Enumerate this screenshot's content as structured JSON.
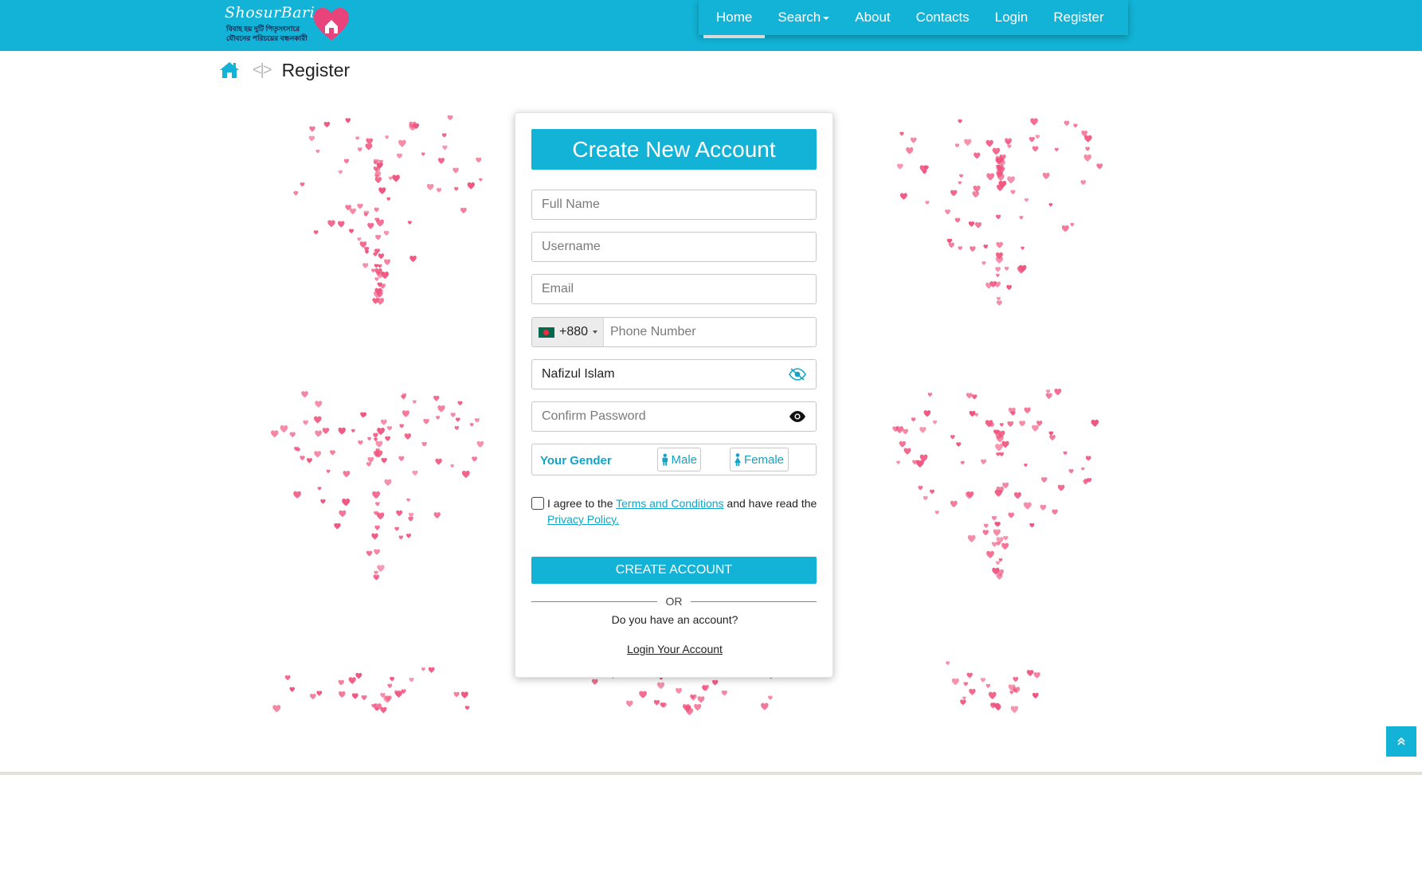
{
  "brand": {
    "name": "ShosurBari",
    "tagline_line1": "বিবাহ হয় দুটি পিতৃসংসারে",
    "tagline_line2": "যৌবনের পরিচয়ের বন্ধনকারী"
  },
  "nav": {
    "items": [
      {
        "label": "Home",
        "active": true
      },
      {
        "label": "Search",
        "dropdown": true
      },
      {
        "label": "About"
      },
      {
        "label": "Contacts"
      },
      {
        "label": "Login"
      },
      {
        "label": "Register"
      }
    ]
  },
  "breadcrumb": {
    "home_icon": "home-icon",
    "separator": "<|>",
    "current": "Register"
  },
  "form": {
    "title": "Create New Account",
    "full_name_placeholder": "Full Name",
    "username_placeholder": "Username",
    "email_placeholder": "Email",
    "phone": {
      "country_flag": "bangladesh-flag-icon",
      "dial_code": "+880",
      "placeholder": "Phone Number"
    },
    "password_value": "Nafizul Islam",
    "confirm_password_placeholder": "Confirm Password",
    "gender": {
      "label": "Your Gender",
      "male": "Male",
      "female": "Female"
    },
    "agree": {
      "prefix": "I agree to the ",
      "terms_link": "Terms and Conditions",
      "middle": " and have read the ",
      "privacy_link": "Privacy Policy.",
      "checked": false
    },
    "submit_label": "CREATE ACCOUNT",
    "or_text": "OR",
    "have_account": "Do you have an account?",
    "login_link": "Login Your Account"
  },
  "colors": {
    "brand": "#12b3d6",
    "heart": "#f0557f"
  }
}
